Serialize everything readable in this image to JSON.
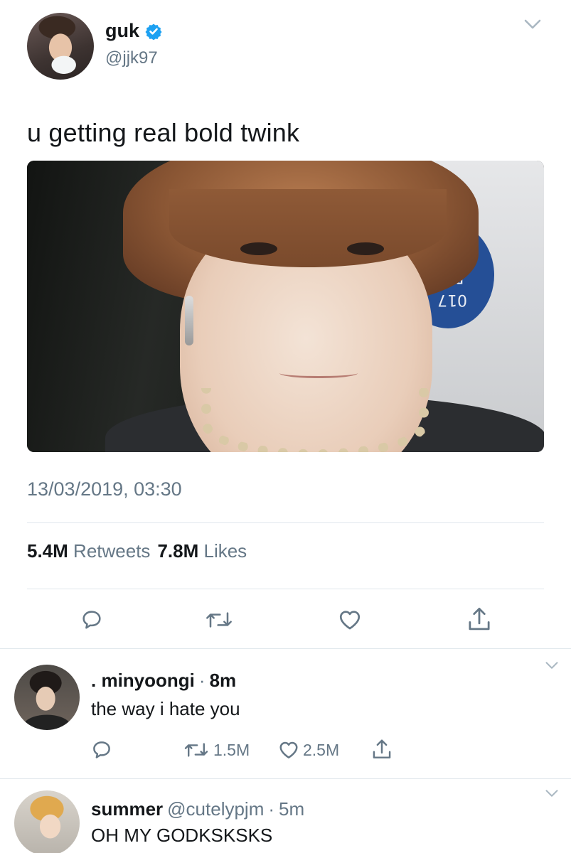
{
  "main_tweet": {
    "display_name": "guk",
    "handle": "@jjk97",
    "text": "u getting real bold twink",
    "photo_sign_text": "017\nRO\n2/2",
    "timestamp": "13/03/2019, 03:30",
    "retweets_count": "5.4M",
    "retweets_label": "Retweets",
    "likes_count": "7.8M",
    "likes_label": "Likes"
  },
  "replies": [
    {
      "display_name": ". minyoongi",
      "separator": "·",
      "time": "8m",
      "text": "the way i hate you",
      "retweets": "1.5M",
      "likes": "2.5M"
    },
    {
      "display_name": "summer",
      "handle": "@cutelypjm",
      "separator": "·",
      "time": "5m",
      "text": "OH MY GODKSKSKS"
    }
  ],
  "colors": {
    "accent": "#1da1f2",
    "secondary_text": "#657786",
    "primary_text": "#14171a",
    "divider": "#e1e8ed"
  },
  "icons": [
    "chevron-down-icon",
    "verified-badge-icon",
    "reply-icon",
    "retweet-icon",
    "like-icon",
    "share-icon"
  ]
}
